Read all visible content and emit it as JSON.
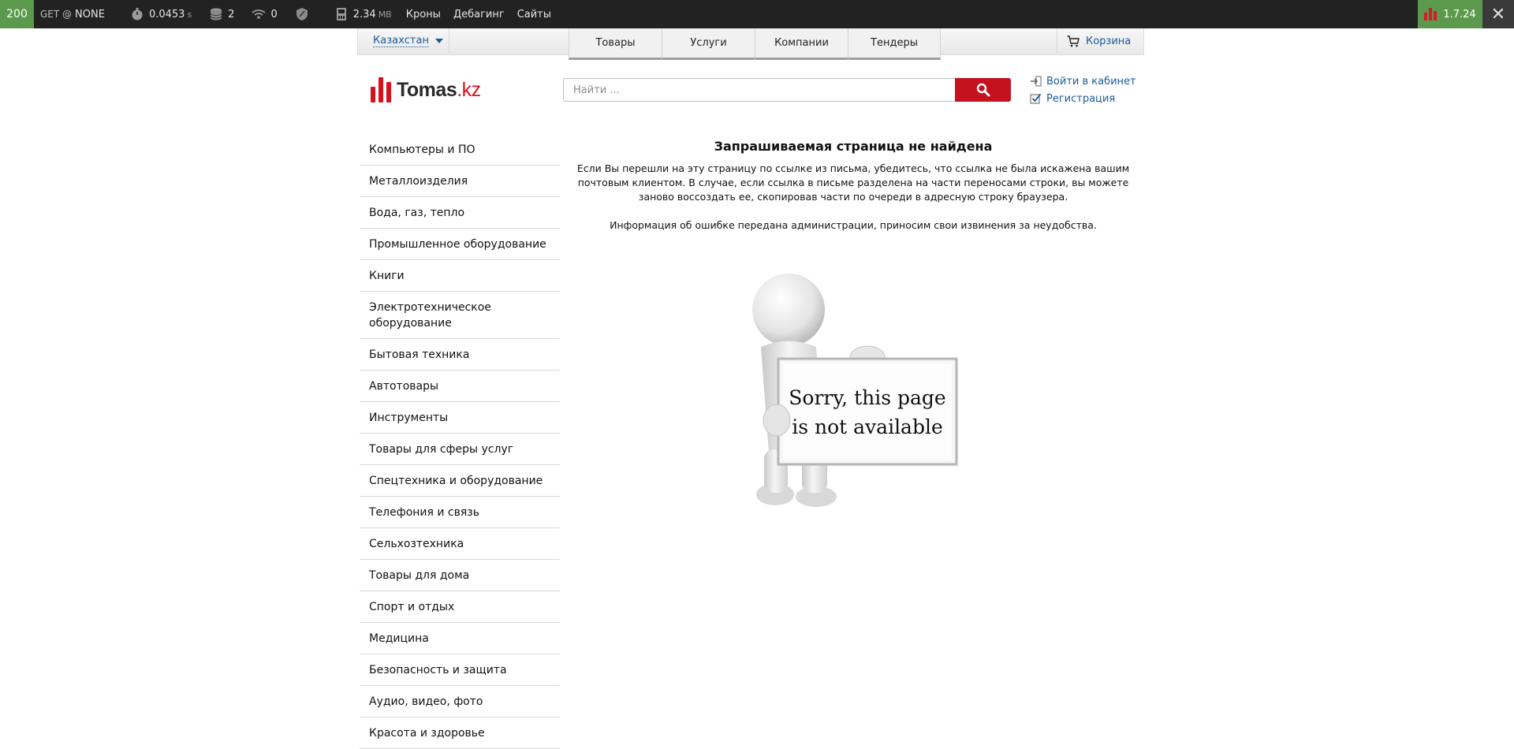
{
  "debug_toolbar": {
    "status_code": "200",
    "method_label": "GET @",
    "route": "NONE",
    "time_value": "0.0453",
    "time_unit": "s",
    "db_queries": "2",
    "ajax_count": "0",
    "memory_value": "2.34",
    "memory_unit": "MB",
    "links": [
      "Кроны",
      "Дебагинг",
      "Сайты"
    ],
    "version": "1.7.24",
    "close_glyph": "✕",
    "accent_color": "#5b9a4c"
  },
  "topbar": {
    "country": "Казахстан",
    "tabs": [
      "Товары",
      "Услуги",
      "Компании",
      "Тендеры"
    ],
    "cart_label": "Корзина"
  },
  "header": {
    "logo_name": "Tomas",
    "logo_tld": ".kz",
    "search_placeholder": "Найти ...",
    "login_label": "Войти в кабинет",
    "register_label": "Регистрация",
    "brand_color": "#d8111d"
  },
  "sidebar": {
    "categories": [
      "Компьютеры и ПО",
      "Металлоизделия",
      "Вода, газ, тепло",
      "Промышленное оборудование",
      "Книги",
      "Электротехническое оборудование",
      "Бытовая техника",
      "Автотовары",
      "Инструменты",
      "Товары для сферы услуг",
      "Спецтехника и оборудование",
      "Телефония и связь",
      "Сельхозтехника",
      "Товары для дома",
      "Спорт и отдых",
      "Медицина",
      "Безопасность и защита",
      "Аудио, видео, фото",
      "Красота и здоровье"
    ]
  },
  "main": {
    "title": "Запрашиваемая страница не найдена",
    "paragraph1": "Если Вы перешли на эту страницу по ссылке из письма, убедитесь, что ссылка не была искажена вашим почтовым клиентом. В случае, если ссылка в письме разделена на части переносами строки, вы можете заново воссоздать ее, скопировав части по очереди в адресную строку браузера.",
    "paragraph2": "Информация об ошибке передана администрации, приносим свои извинения за неудобства.",
    "sign_line1": "Sorry, this page",
    "sign_line2": "is not available"
  }
}
